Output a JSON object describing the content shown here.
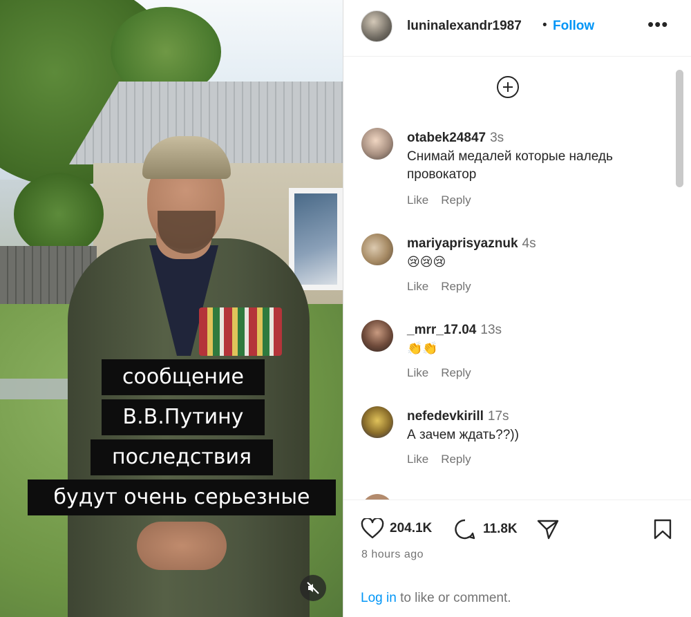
{
  "video": {
    "captions": [
      "сообщение",
      "В.В.Путину",
      "последствия",
      "будут очень серьезные"
    ],
    "mute_icon": "muted-speaker-icon"
  },
  "post": {
    "username": "luninalexandr1987",
    "separator": "•",
    "follow_label": "Follow",
    "more_label": "•••",
    "add_icon": "plus-circle-icon"
  },
  "comments": [
    {
      "user": "otabek24847",
      "time": "3s",
      "text": "Снимай медалей которые наледь провокатор",
      "like": "Like",
      "reply": "Reply"
    },
    {
      "user": "mariyaprisyaznuk",
      "time": "4s",
      "text": "😢😢😢",
      "like": "Like",
      "reply": "Reply"
    },
    {
      "user": "_mrr_17.04",
      "time": "13s",
      "text": "👏👏",
      "like": "Like",
      "reply": "Reply"
    },
    {
      "user": "nefedevkirill",
      "time": "17s",
      "text": "А зачем ждать??))",
      "like": "Like",
      "reply": "Reply"
    }
  ],
  "actions": {
    "likes": "204.1K",
    "comments": "11.8K",
    "time_ago": "8 hours ago"
  },
  "login": {
    "link": "Log in",
    "rest": "to like or comment."
  },
  "colors": {
    "link": "#0095f6",
    "text": "#262626",
    "muted": "#737373"
  }
}
